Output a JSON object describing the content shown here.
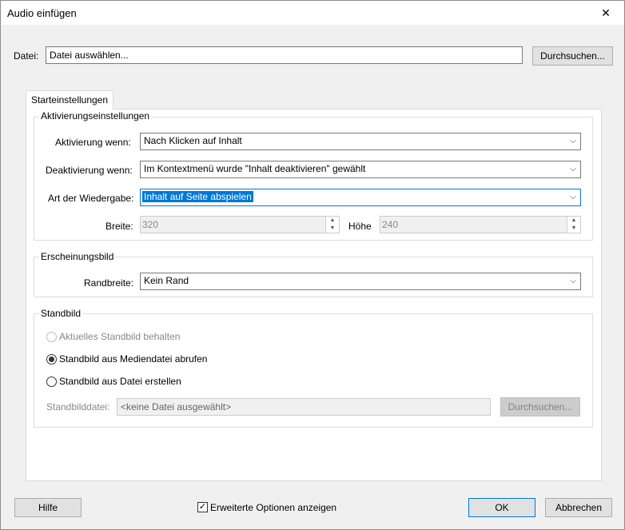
{
  "window": {
    "title": "Audio einfügen",
    "close_glyph": "✕"
  },
  "file": {
    "label": "Datei:",
    "value": "Datei auswählen...",
    "browse_label": "Durchsuchen..."
  },
  "tab": {
    "label": "Starteinstellungen"
  },
  "activation": {
    "group_title": "Aktivierungseinstellungen",
    "activate_label": "Aktivierung wenn:",
    "activate_value": "Nach Klicken auf Inhalt",
    "deactivate_label": "Deaktivierung wenn:",
    "deactivate_value": "Im Kontextmenü wurde \"Inhalt deaktivieren\" gewählt",
    "playback_label": "Art der Wiedergabe:",
    "playback_value": "Inhalt auf Seite abspielen",
    "width_label": "Breite:",
    "width_value": "320",
    "height_label": "Höhe",
    "height_value": "240"
  },
  "appearance": {
    "group_title": "Erscheinungsbild",
    "border_label": "Randbreite:",
    "border_value": "Kein Rand"
  },
  "poster": {
    "group_title": "Standbild",
    "option1": "Aktuelles Standbild behalten",
    "option2": "Standbild aus Mediendatei abrufen",
    "option3": "Standbild aus Datei erstellen",
    "file_label": "Standbilddatei:",
    "file_value": "<keine Datei ausgewählt>",
    "browse_label": "Durchsuchen..."
  },
  "footer": {
    "help_label": "Hilfe",
    "advanced_label": "Erweiterte Optionen anzeigen",
    "advanced_checked": true,
    "ok_label": "OK",
    "cancel_label": "Abbrechen"
  }
}
